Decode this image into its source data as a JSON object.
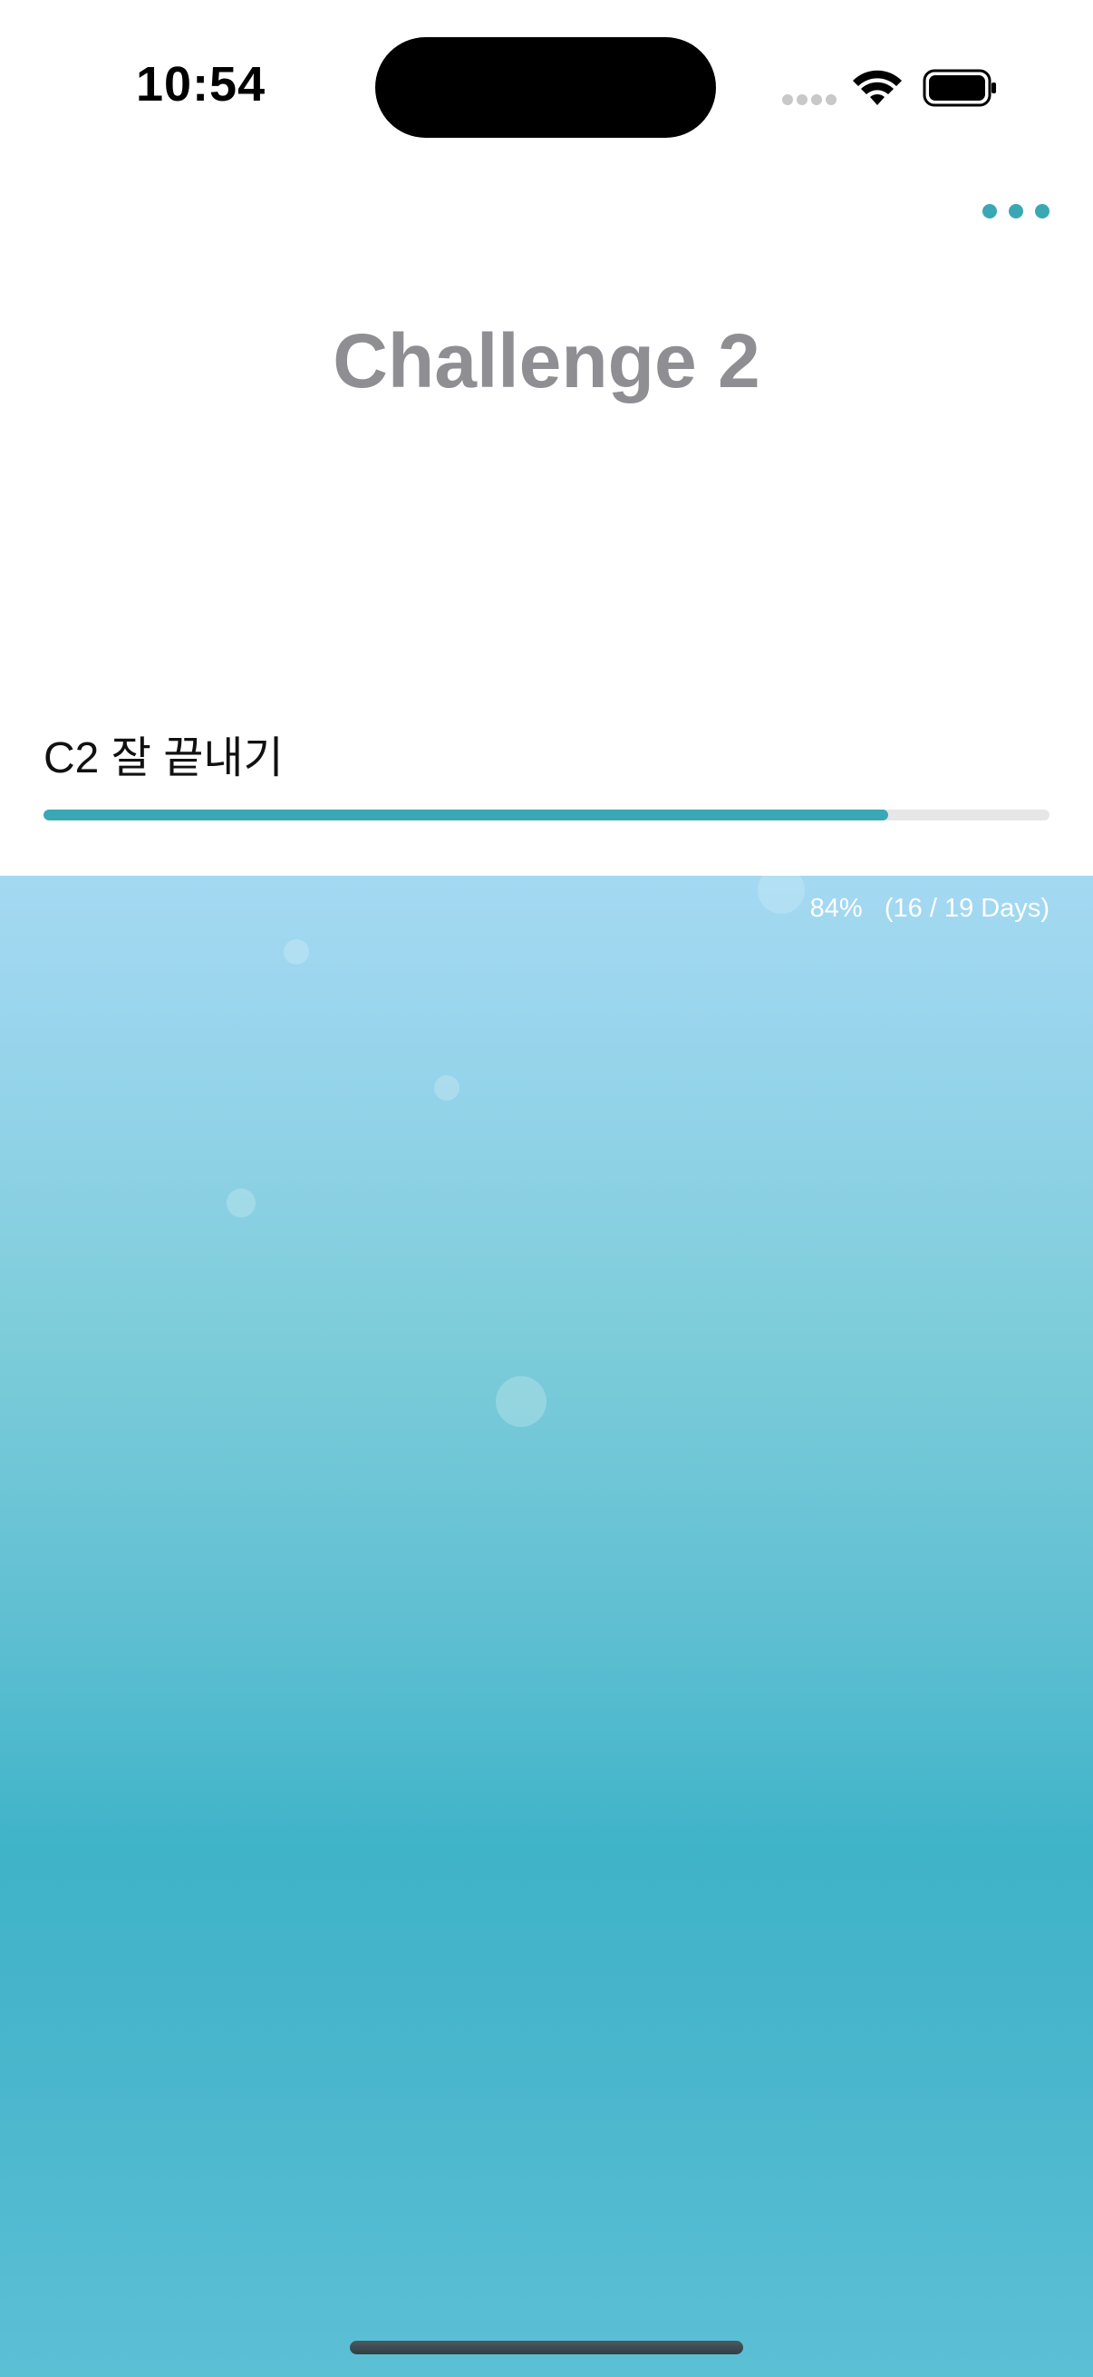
{
  "status_bar": {
    "time": "10:54"
  },
  "header": {
    "title": "Challenge 2",
    "menu_icon": "ellipsis-icon"
  },
  "goal": {
    "label": "C2 잘 끝내기",
    "progress_fraction": 0.84,
    "percent_text": "84%",
    "days_text": "(16 / 19 Days)"
  },
  "colors": {
    "accent": "#3aa8b4",
    "title_gray": "#8e8e93",
    "track": "#e6e6e6",
    "water_top": "#a4d9f2",
    "water_mid": "#3fb3c8"
  }
}
